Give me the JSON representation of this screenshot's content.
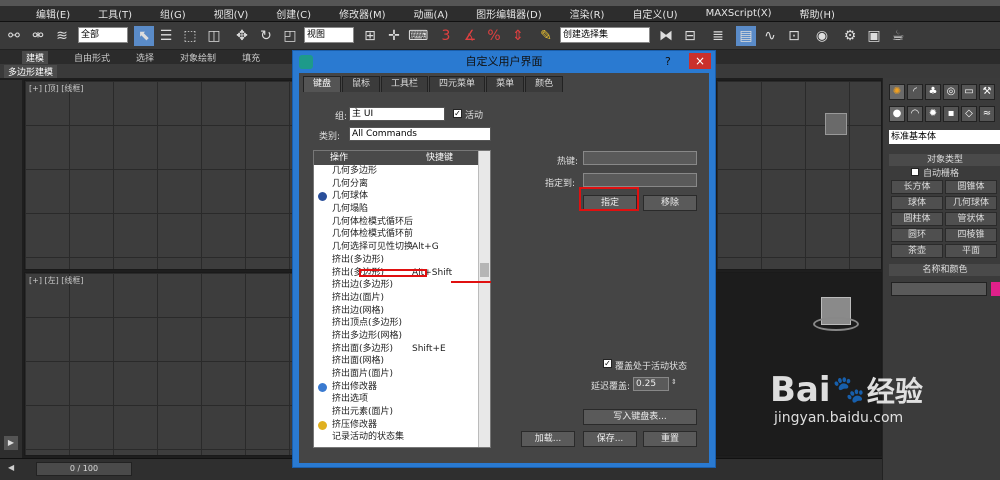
{
  "menubar": {
    "items": [
      "编辑(E)",
      "工具(T)",
      "组(G)",
      "视图(V)",
      "创建(C)",
      "修改器(M)",
      "动画(A)",
      "图形编辑器(D)",
      "渲染(R)",
      "自定义(U)",
      "MAXScript(X)",
      "帮助(H)"
    ]
  },
  "toolbar": {
    "filter_value": "全部",
    "view_value": "视图",
    "selection_set": "创建选择集"
  },
  "ribbon": {
    "tabs": [
      "建模",
      "自由形式",
      "选择",
      "对象绘制",
      "填充"
    ],
    "sub_tab": "多边形建模"
  },
  "viewports": {
    "top_left": "[+] [顶] [线框]",
    "bottom_left": "[+] [左] [线框]"
  },
  "timeline": {
    "frame": "0 / 100"
  },
  "right_panel": {
    "dropdown": "标准基本体",
    "object_type_header": "对象类型",
    "autogrid_label": "自动栅格",
    "buttons": [
      "长方体",
      "圆锥体",
      "球体",
      "几何球体",
      "圆柱体",
      "管状体",
      "圆环",
      "四棱锥",
      "茶壶",
      "平面"
    ],
    "name_color_header": "名称和颜色"
  },
  "dialog": {
    "title": "自定义用户界面",
    "help": "?",
    "close": "×",
    "tabs": [
      "键盘",
      "鼠标",
      "工具栏",
      "四元菜单",
      "菜单",
      "颜色"
    ],
    "group_label": "组:",
    "group_value": "主 UI",
    "active_label": "活动",
    "category_label": "类别:",
    "category_value": "All Commands",
    "list_header_action": "操作",
    "list_header_shortcut": "快捷键",
    "list_items": [
      {
        "label": "几何多边形",
        "shortcut": ""
      },
      {
        "label": "几何分离",
        "shortcut": ""
      },
      {
        "label": "几何球体",
        "shortcut": ""
      },
      {
        "label": "几何塌陷",
        "shortcut": ""
      },
      {
        "label": "几何体检模式循环后",
        "shortcut": ""
      },
      {
        "label": "几何体检模式循环前",
        "shortcut": ""
      },
      {
        "label": "几何选择可见性切换",
        "shortcut": "Alt+G"
      },
      {
        "label": "挤出(多边形)",
        "shortcut": ""
      },
      {
        "label": "挤出(多边形)",
        "shortcut": "Alt+Shift"
      },
      {
        "label": "挤出边(多边形)",
        "shortcut": ""
      },
      {
        "label": "挤出边(面片)",
        "shortcut": ""
      },
      {
        "label": "挤出边(网格)",
        "shortcut": ""
      },
      {
        "label": "挤出顶点(多边形)",
        "shortcut": ""
      },
      {
        "label": "挤出多边形(网格)",
        "shortcut": ""
      },
      {
        "label": "挤出面(多边形)",
        "shortcut": "Shift+E"
      },
      {
        "label": "挤出面(网格)",
        "shortcut": ""
      },
      {
        "label": "挤出面片(面片)",
        "shortcut": ""
      },
      {
        "label": "挤出修改器",
        "shortcut": ""
      },
      {
        "label": "挤出选项",
        "shortcut": ""
      },
      {
        "label": "挤出元素(面片)",
        "shortcut": ""
      },
      {
        "label": "挤压修改器",
        "shortcut": ""
      },
      {
        "label": "记录活动的状态集",
        "shortcut": ""
      }
    ],
    "hotkey_label": "热键:",
    "assigned_label": "指定到:",
    "assign_button": "指定",
    "remove_button": "移除",
    "overwrite_label": "覆盖处于活动状态",
    "delay_label": "延迟覆盖:",
    "delay_value": "0.25",
    "write_button": "写入键盘表...",
    "load_button": "加载...",
    "save_button": "保存...",
    "reset_button": "重置"
  },
  "watermark": {
    "brand": "Bai",
    "brand2": "经验",
    "url": "jingyan.baidu.com"
  }
}
